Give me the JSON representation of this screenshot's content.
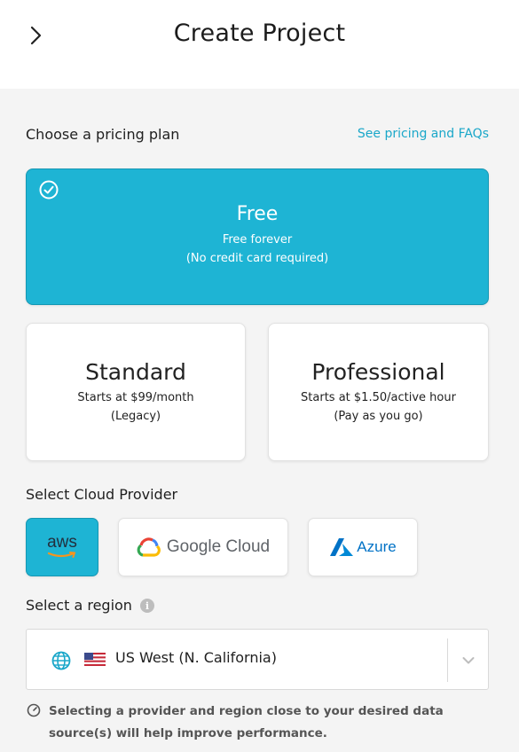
{
  "header": {
    "title": "Create Project",
    "back_icon": "chevron-right-icon"
  },
  "pricing": {
    "label": "Choose a pricing plan",
    "link": "See pricing and FAQs",
    "plans": [
      {
        "name": "Free",
        "line1": "Free forever",
        "line2": "(No credit card required)",
        "selected": true
      },
      {
        "name": "Standard",
        "line1": "Starts at $99/month",
        "line2": "(Legacy)",
        "selected": false
      },
      {
        "name": "Professional",
        "line1": "Starts at $1.50/active hour",
        "line2": "(Pay as you go)",
        "selected": false
      }
    ]
  },
  "cloud": {
    "label": "Select Cloud Provider",
    "providers": [
      {
        "name": "aws",
        "selected": true
      },
      {
        "name": "Google Cloud",
        "selected": false
      },
      {
        "name": "Azure",
        "selected": false
      }
    ]
  },
  "region": {
    "label": "Select a region",
    "value": "US West (N. California)"
  },
  "hint": "Selecting a provider and region close to your desired data source(s) will help improve performance.",
  "colors": {
    "accent": "#1eb4d4",
    "link": "#1aa7c9"
  }
}
